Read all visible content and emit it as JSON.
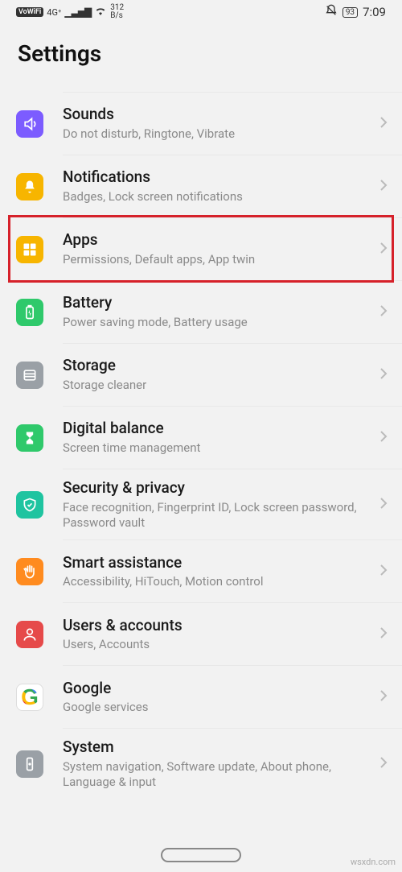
{
  "status": {
    "vowifi": "VoWiFi",
    "net": "4G⁺",
    "signal": "▁▃▅▇",
    "wifi": "☰",
    "rate": "312",
    "rate_unit": "B/s",
    "battery": "93",
    "time": "7:09"
  },
  "header": {
    "title": "Settings"
  },
  "items": [
    {
      "title": "Sounds",
      "sub": "Do not disturb, Ringtone, Vibrate",
      "icon": "sound",
      "color": "#7c5cff"
    },
    {
      "title": "Notifications",
      "sub": "Badges, Lock screen notifications",
      "icon": "bell",
      "color": "#f7b500"
    },
    {
      "title": "Apps",
      "sub": "Permissions, Default apps, App twin",
      "icon": "apps",
      "color": "#f7b500"
    },
    {
      "title": "Battery",
      "sub": "Power saving mode, Battery usage",
      "icon": "battery",
      "color": "#2fc96b"
    },
    {
      "title": "Storage",
      "sub": "Storage cleaner",
      "icon": "storage",
      "color": "#9aa0a6"
    },
    {
      "title": "Digital balance",
      "sub": "Screen time management",
      "icon": "hourglass",
      "color": "#2fc96b"
    },
    {
      "title": "Security & privacy",
      "sub": "Face recognition, Fingerprint ID, Lock screen password, Password vault",
      "icon": "shield",
      "color": "#1fc4a0"
    },
    {
      "title": "Smart assistance",
      "sub": "Accessibility, HiTouch, Motion control",
      "icon": "hand",
      "color": "#ff8b1f"
    },
    {
      "title": "Users & accounts",
      "sub": "Users, Accounts",
      "icon": "user",
      "color": "#e64a4a"
    },
    {
      "title": "Google",
      "sub": "Google services",
      "icon": "google",
      "color": "#ffffff"
    },
    {
      "title": "System",
      "sub": "System navigation, Software update, About phone, Language & input",
      "icon": "system",
      "color": "#9aa0a6"
    }
  ],
  "highlight_index": 2,
  "watermark": "wsxdn.com"
}
